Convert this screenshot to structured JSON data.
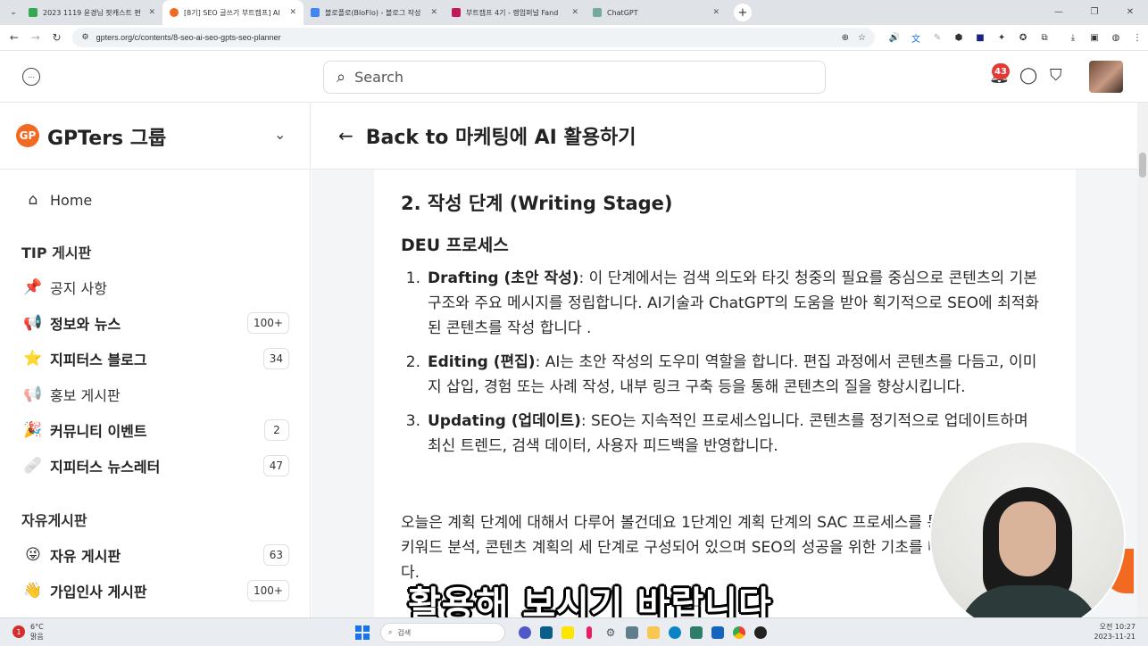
{
  "browser": {
    "tabs": [
      {
        "title": "2023 1119 윤경님 팟캐스트 편",
        "color": "#34a853",
        "active": false
      },
      {
        "title": "[8기] SEO 글쓰기 부트캠프] AI",
        "color": "#f26a21",
        "active": true
      },
      {
        "title": "블로플로(BloFlo) - 블로그 작성",
        "color": "#4285f4",
        "active": false
      },
      {
        "title": "부트캠프 4기 - 랭엄퍼널 Fand",
        "color": "#c2185b",
        "active": false
      },
      {
        "title": "ChatGPT",
        "color": "#74aa9c",
        "active": false
      }
    ],
    "url": "gpters.org/c/contents/8-seo-ai-seo-gpts-seo-planner"
  },
  "header": {
    "search_placeholder": "Search",
    "notification_count": "43"
  },
  "sidebar": {
    "group_name": "GPTers 그룹",
    "home_label": "Home",
    "sections": [
      {
        "title": "TIP 게시판",
        "items": [
          {
            "emoji": "📌",
            "label": "공지 사항",
            "count": "",
            "bold": false
          },
          {
            "emoji": "📢",
            "label": "정보와 뉴스",
            "count": "100+",
            "bold": true
          },
          {
            "emoji": "⭐",
            "label": "지피터스 블로그",
            "count": "34",
            "bold": true
          },
          {
            "emoji": "📢",
            "label": "홍보 게시판",
            "count": "",
            "bold": false
          },
          {
            "emoji": "🎉",
            "label": "커뮤니티 이벤트",
            "count": "2",
            "bold": true
          },
          {
            "emoji": "🩹",
            "label": "지피터스 뉴스레터",
            "count": "47",
            "bold": true
          }
        ]
      },
      {
        "title": "자유게시판",
        "items": [
          {
            "emoji": "😜",
            "label": "자유 게시판",
            "count": "63",
            "bold": true
          },
          {
            "emoji": "👋",
            "label": "가입인사 게시판",
            "count": "100+",
            "bold": true
          }
        ]
      }
    ]
  },
  "main": {
    "back_text": "Back to 마케팅에 AI 활용하기",
    "heading": "2. 작성 단계 (Writing Stage)",
    "subheading": "DEU 프로세스",
    "list": [
      {
        "num": "1.",
        "term": "Drafting (초안 작성)",
        "text": ": 이 단계에서는 검색 의도와 타깃 청중의 필요를 중심으로 콘텐츠의 기본 구조와 주요 메시지를 정립합니다. AI기술과 ChatGPT의 도움을 받아 획기적으로 SEO에 최적화된 콘텐츠를 작성 합니다 ."
      },
      {
        "num": "2.",
        "term": "Editing (편집)",
        "text": ": AI는 초안 작성의 도우미 역할을 합니다. 편집 과정에서 콘텐츠를 다듬고, 이미지 삽입, 경험 또는 사례 작성, 내부 링크 구축 등을 통해 콘텐츠의 질을 향상시킵니다."
      },
      {
        "num": "3.",
        "term": "Updating (업데이트)",
        "text": ": SEO는 지속적인 프로세스입니다. 콘텐츠를 정기적으로 업데이트하며 최신 트렌드, 검색 데이터, 사용자 피드백을 반영합니다."
      }
    ],
    "paragraph": "오늘은 계획 단계에 대해서 다루어 볼건데요 1단계인 계획 단계의 SAC 프로세스를 통해 키워드 선정, 키워드 분석, 콘텐츠 계획의 세 단계로 구성되어 있으며 SEO의 성공을 위한 기초를 마련 할 수 있습니다."
  },
  "caption": "활용해 보시기 바랍니다",
  "taskbar": {
    "weather_temp": "6°C",
    "weather_desc": "맑음",
    "search_label": "검색",
    "time": "오전 10:27",
    "date": "2023-11-21"
  }
}
